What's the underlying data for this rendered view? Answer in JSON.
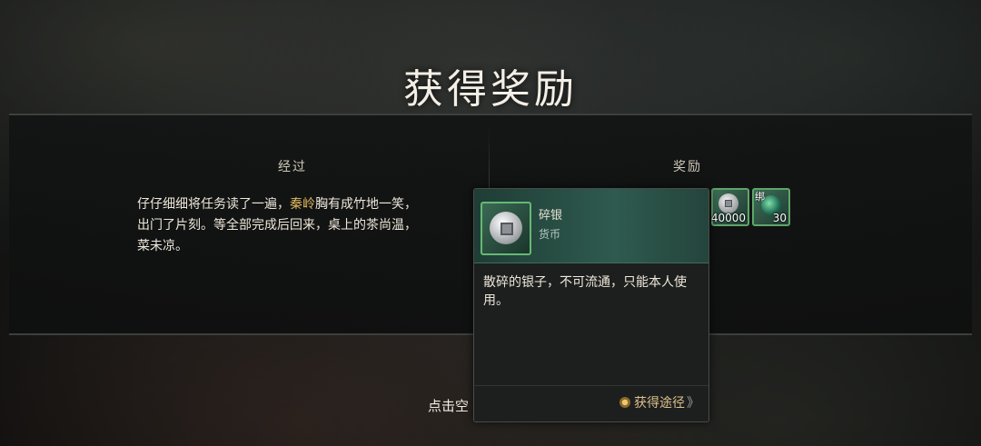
{
  "title": "获得奖励",
  "left_column": {
    "header": "经过",
    "text_line1_pre": "仔仔细细将任务读了一遍，",
    "text_line1_name": "秦岭",
    "text_line1_post": "胸有成竹地一笑，",
    "text_line2": "出门了片刻。等全部完成后回来，桌上的茶尚温，",
    "text_line3": "菜未凉。"
  },
  "right_column": {
    "header": "奖励",
    "items": [
      {
        "icon": "silver-coin-icon",
        "quantity": "40000"
      },
      {
        "icon": "green-orb-icon",
        "quantity": "30",
        "tag": "绑"
      }
    ]
  },
  "hint": "点击空",
  "tooltip": {
    "name": "碎银",
    "type": "货币",
    "description": "散碎的银子，不可流通，只能本人使用。",
    "link_label": "获得途径",
    "link_arrow": "》"
  },
  "colors": {
    "highlight": "#e0b860",
    "frame_green": "#5fa56a",
    "tooltip_header": "#2f5a4f"
  }
}
